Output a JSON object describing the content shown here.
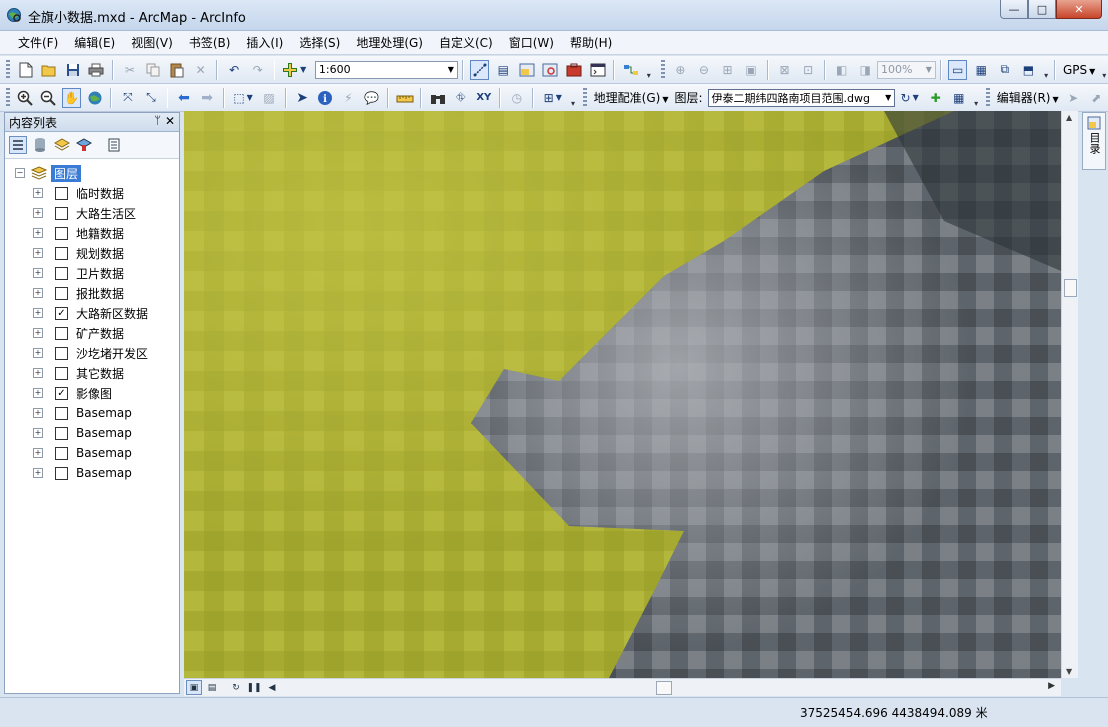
{
  "window": {
    "title": "全旗小数据.mxd - ArcMap - ArcInfo",
    "min_label": "—",
    "max_label": "□",
    "close_label": "✕"
  },
  "menu": [
    "文件(F)",
    "编辑(E)",
    "视图(V)",
    "书签(B)",
    "插入(I)",
    "选择(S)",
    "地理处理(G)",
    "自定义(C)",
    "窗口(W)",
    "帮助(H)"
  ],
  "toolbar1": {
    "scale": "1:600",
    "zoom": "100%",
    "gps_label": "GPS"
  },
  "toolbar2": {
    "georef_label": "地理配准(G)",
    "layer_label": "图层:",
    "layer_value": "伊泰二期纬四路南项目范围.dwg",
    "editor_label": "编辑器(R)"
  },
  "toc": {
    "title": "内容列表",
    "pin": "ᛘ",
    "close": "✕",
    "root_label": "图层",
    "layers": [
      {
        "label": "临时数据",
        "checked": false
      },
      {
        "label": "大路生活区",
        "checked": false
      },
      {
        "label": "地籍数据",
        "checked": false
      },
      {
        "label": "规划数据",
        "checked": false
      },
      {
        "label": "卫片数据",
        "checked": false
      },
      {
        "label": "报批数据",
        "checked": false
      },
      {
        "label": "大路新区数据",
        "checked": true
      },
      {
        "label": "矿产数据",
        "checked": false
      },
      {
        "label": "沙圪堵开发区",
        "checked": false
      },
      {
        "label": "其它数据",
        "checked": false
      },
      {
        "label": "影像图",
        "checked": true
      },
      {
        "label": "Basemap",
        "checked": false
      },
      {
        "label": "Basemap",
        "checked": false
      },
      {
        "label": "Basemap",
        "checked": false
      },
      {
        "label": "Basemap",
        "checked": false
      }
    ]
  },
  "side_dock": {
    "label": "目录"
  },
  "status": {
    "coordinates": "37525454.696  4438494.089 米"
  },
  "colors": {
    "map_yellow": "#a8ac34",
    "map_gray": "#6f757a",
    "selection": "#3a7bd5"
  }
}
